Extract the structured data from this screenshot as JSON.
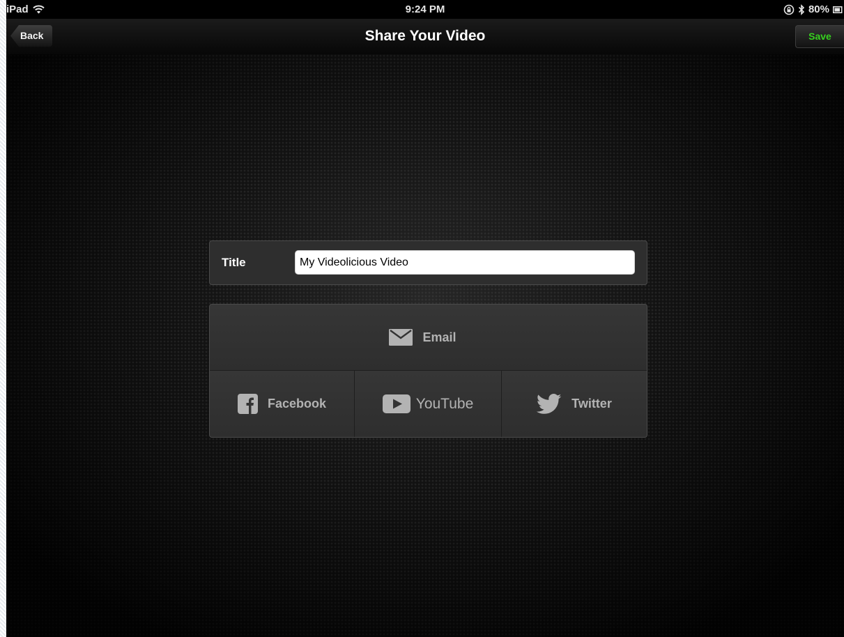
{
  "status_bar": {
    "device": "iPad",
    "time": "9:24 PM",
    "battery": "80%"
  },
  "nav_bar": {
    "back_label": "Back",
    "title": "Share Your Video",
    "save_label": "Save",
    "save_color": "#37d21f"
  },
  "title_field": {
    "label": "Title",
    "value": "My Videolicious Video"
  },
  "share": {
    "email_label": "Email",
    "facebook_label": "Facebook",
    "youtube_label": "YouTube",
    "twitter_label": "Twitter",
    "icons": [
      "envelope-icon",
      "facebook-icon",
      "youtube-icon",
      "twitter-icon"
    ]
  }
}
